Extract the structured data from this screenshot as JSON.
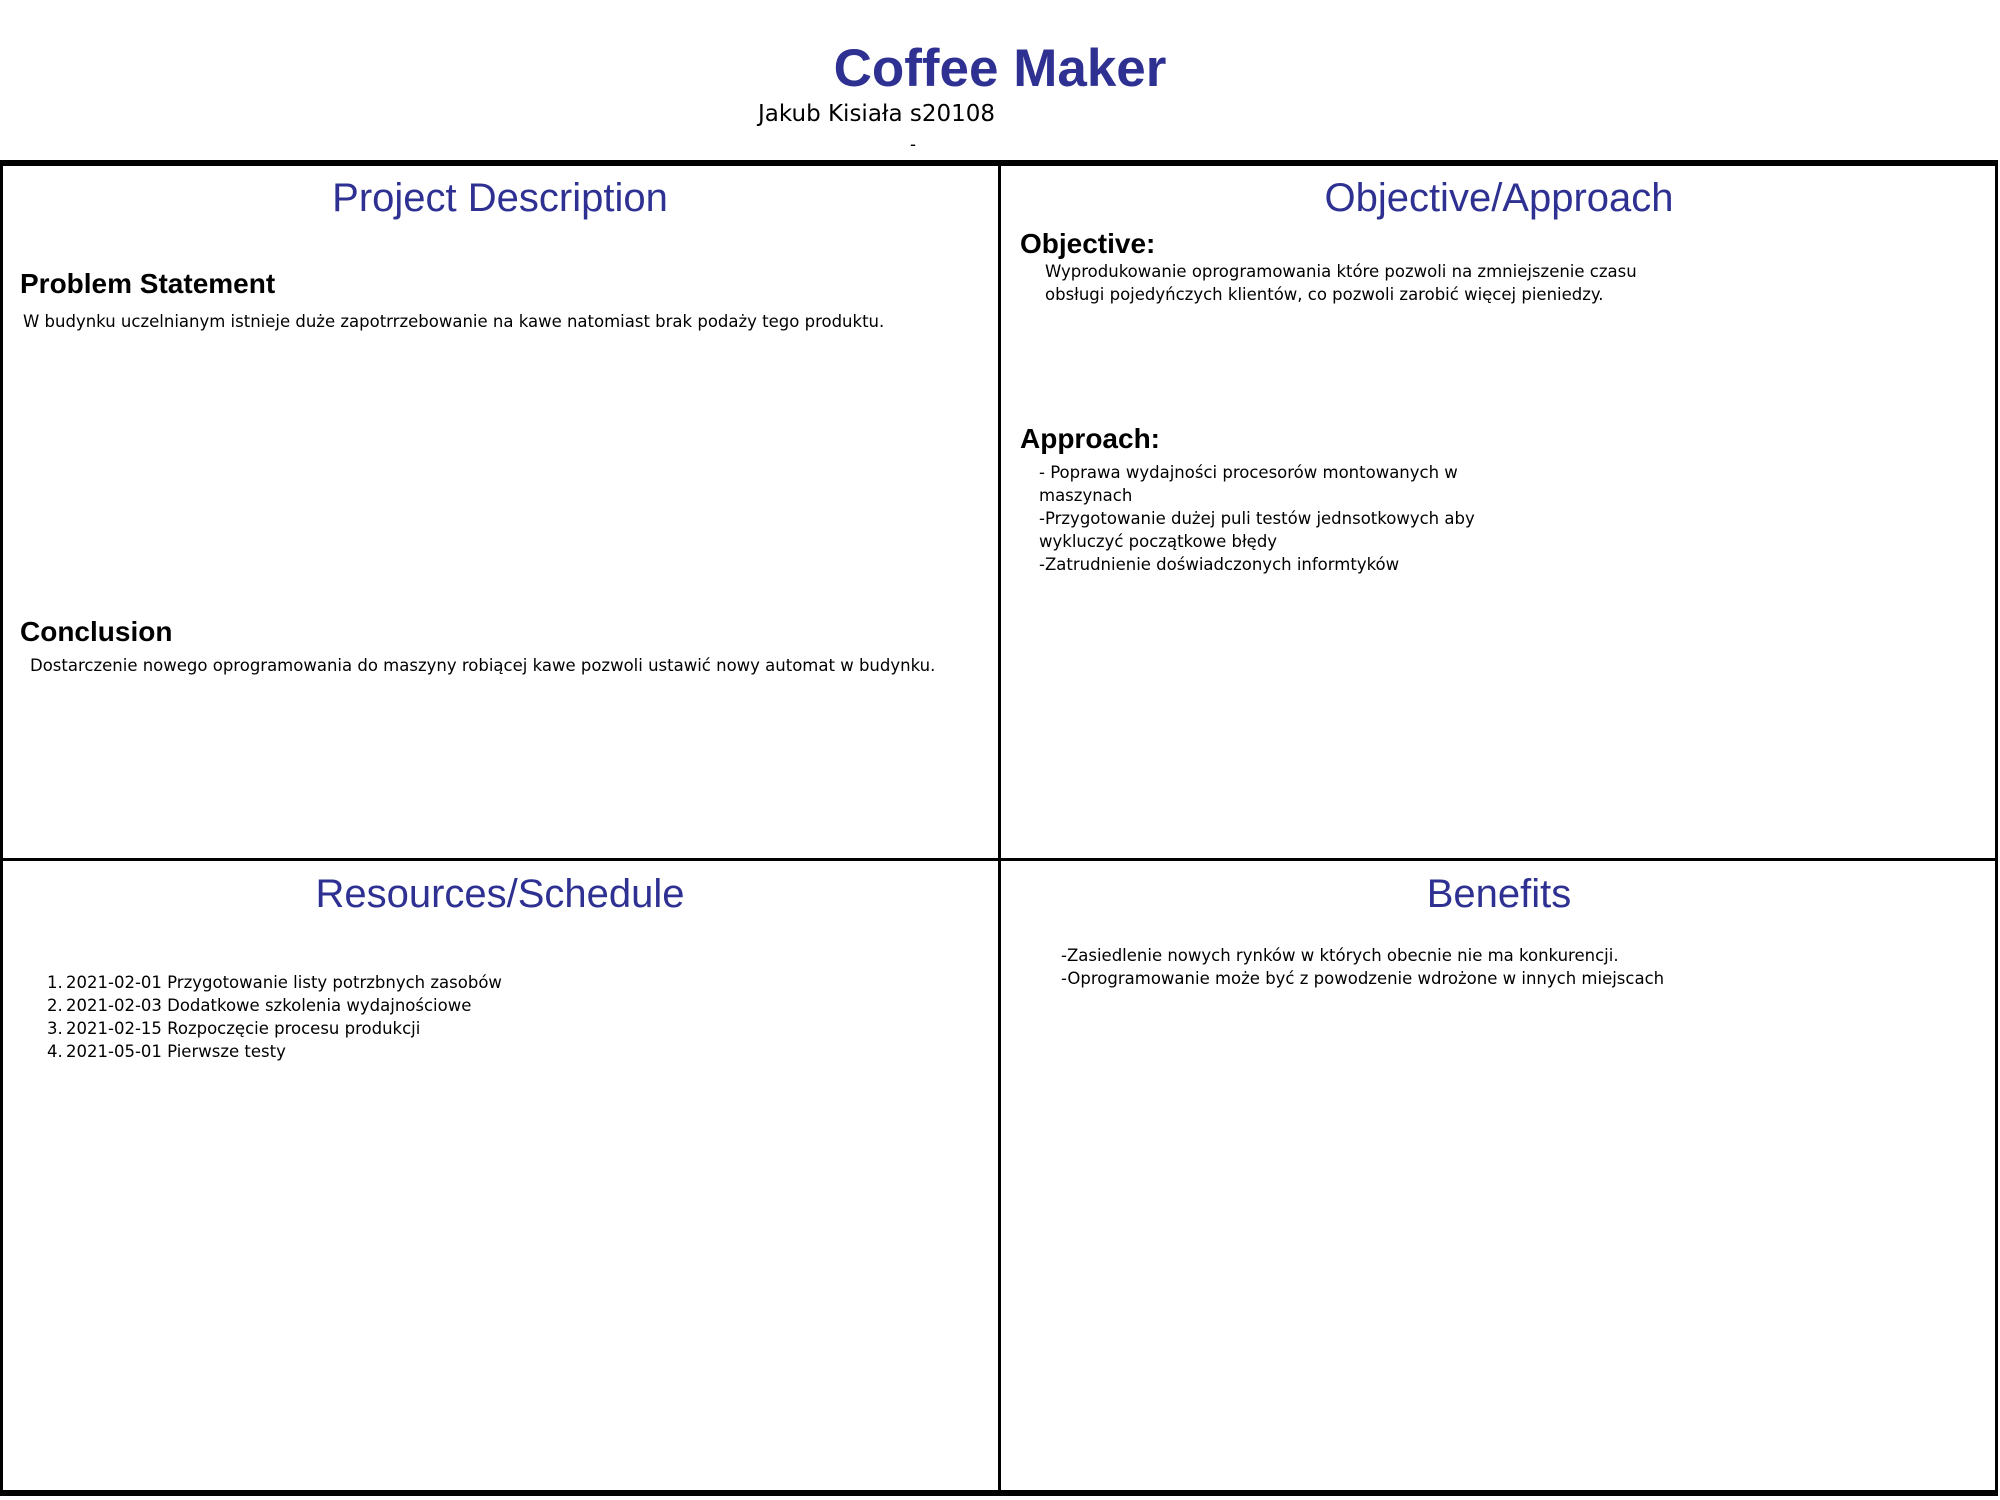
{
  "header": {
    "title": "Coffee Maker",
    "author": "Jakub Kisiała s20108",
    "mark": "-"
  },
  "project_description": {
    "title": "Project Description",
    "problem_heading": "Problem Statement",
    "problem_text": "W budynku uczelnianym istnieje duże zapotrrzebowanie na kawe natomiast brak podaży tego produktu.",
    "conclusion_heading": "Conclusion",
    "conclusion_text": "Dostarczenie nowego oprogramowania do maszyny robiącej kawe pozwoli ustawić nowy automat w budynku."
  },
  "objective_approach": {
    "title": "Objective/Approach",
    "objective_heading": "Objective:",
    "objective_lines": [
      "Wyprodukowanie oprogramowania które pozwoli na zmniejszenie czasu",
      "obsługi pojedyńczych klientów, co pozwoli zarobić więcej pieniedzy."
    ],
    "approach_heading": "Approach:",
    "approach_lines": [
      "- Poprawa wydajności procesorów montowanych w",
      "maszynach",
      "-Przygotowanie dużej puli testów jednsotkowych aby",
      "wykluczyć początkowe błędy",
      "-Zatrudnienie doświadczonych informtyków"
    ]
  },
  "resources_schedule": {
    "title": "Resources/Schedule",
    "items": [
      {
        "num": "1.",
        "text": "2021-02-01 Przygotowanie listy potrzbnych zasobów"
      },
      {
        "num": "2.",
        "text": "2021-02-03 Dodatkowe szkolenia wydajnościowe"
      },
      {
        "num": "3.",
        "text": "2021-02-15 Rozpoczęcie procesu produkcji"
      },
      {
        "num": "4.",
        "text": "2021-05-01 Pierwsze testy"
      }
    ]
  },
  "benefits": {
    "title": "Benefits",
    "lines": [
      "-Zasiedlenie nowych rynków w których obecnie nie ma konkurencji.",
      "-Oprogramowanie może być z powodzenie wdrożone w innych miejscach"
    ]
  },
  "colors": {
    "heading_blue": "#2e3192",
    "border": "#000000",
    "background": "#ffffff"
  }
}
